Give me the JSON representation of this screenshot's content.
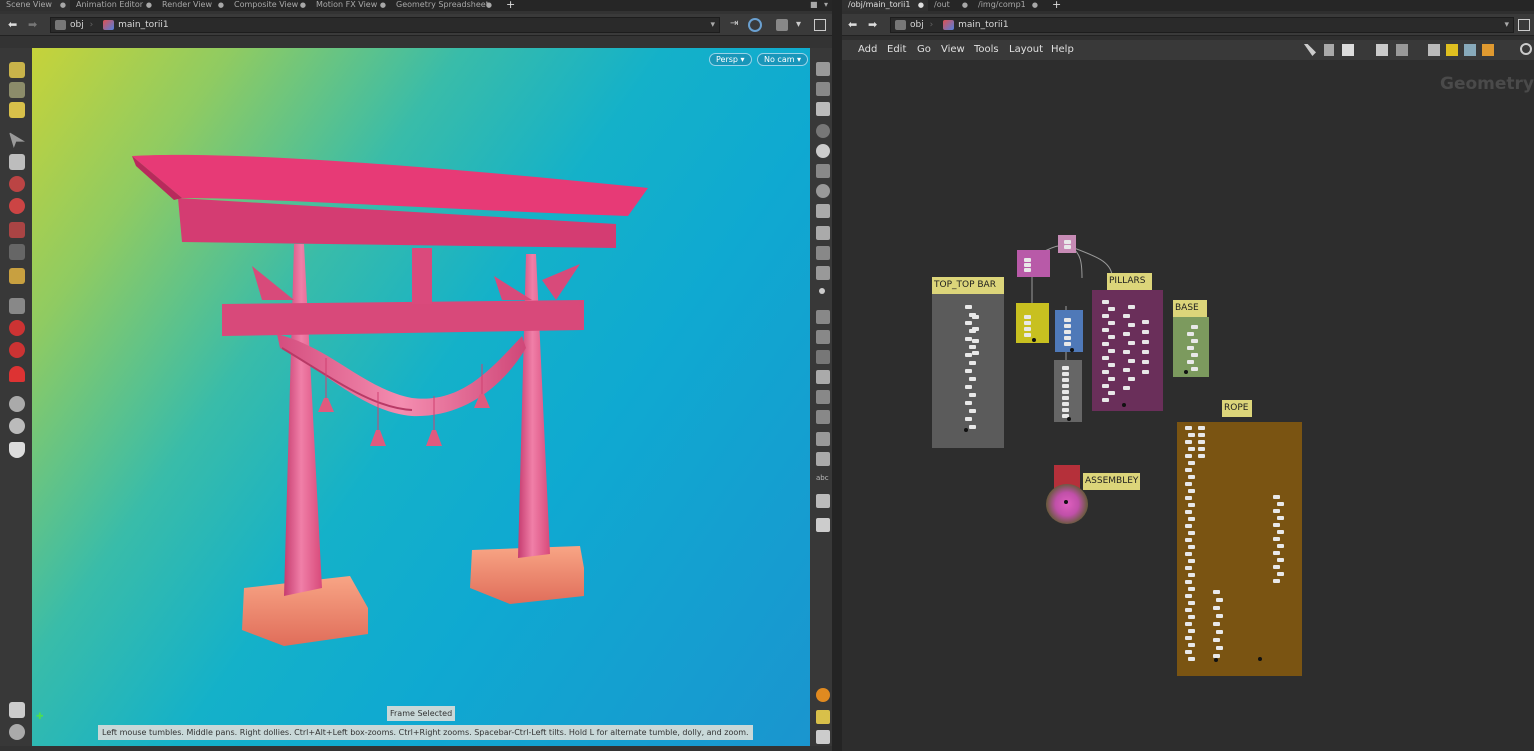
{
  "left_pane": {
    "tabs": [
      {
        "label": "Scene View"
      },
      {
        "label": "Animation Editor"
      },
      {
        "label": "Render View"
      },
      {
        "label": "Composite View"
      },
      {
        "label": "Motion FX View"
      },
      {
        "label": "Geometry Spreadsheet"
      }
    ],
    "path": {
      "context": "obj",
      "node": "main_torii1"
    },
    "viewport": {
      "view_mode": "Persp",
      "camera": "No cam",
      "status_message": "Frame Selected",
      "hint_text": "Left mouse tumbles. Middle pans. Right dollies. Ctrl+Alt+Left box-zooms. Ctrl+Right zooms. Spacebar-Ctrl-Left tilts. Hold L for alternate tumble, dolly, and zoom."
    }
  },
  "right_pane": {
    "tabs": [
      {
        "label": "/obj/main_torii1"
      },
      {
        "label": "/out"
      },
      {
        "label": "/img/comp1"
      }
    ],
    "path": {
      "context": "obj",
      "node": "main_torii1"
    },
    "menu": [
      {
        "label": "Add"
      },
      {
        "label": "Edit"
      },
      {
        "label": "Go"
      },
      {
        "label": "View"
      },
      {
        "label": "Tools"
      },
      {
        "label": "Layout"
      },
      {
        "label": "Help"
      }
    ],
    "network": {
      "watermark": "Geometry",
      "boxes": [
        {
          "label": "TOP_TOP BAR",
          "color": "#5b5b5b"
        },
        {
          "label": "PILLARS",
          "color": "#6a2f5a"
        },
        {
          "label": "BASE",
          "color": "#7c9a5e"
        },
        {
          "label": "ROPE",
          "color": "#7a5412"
        },
        {
          "label": "ASSEMBLEY",
          "color": "#b5303a"
        }
      ]
    }
  },
  "colors": {
    "torii_pink": "#e2356f",
    "torii_base": "#f08a6d",
    "node_label_bg": "#dcd57a"
  }
}
